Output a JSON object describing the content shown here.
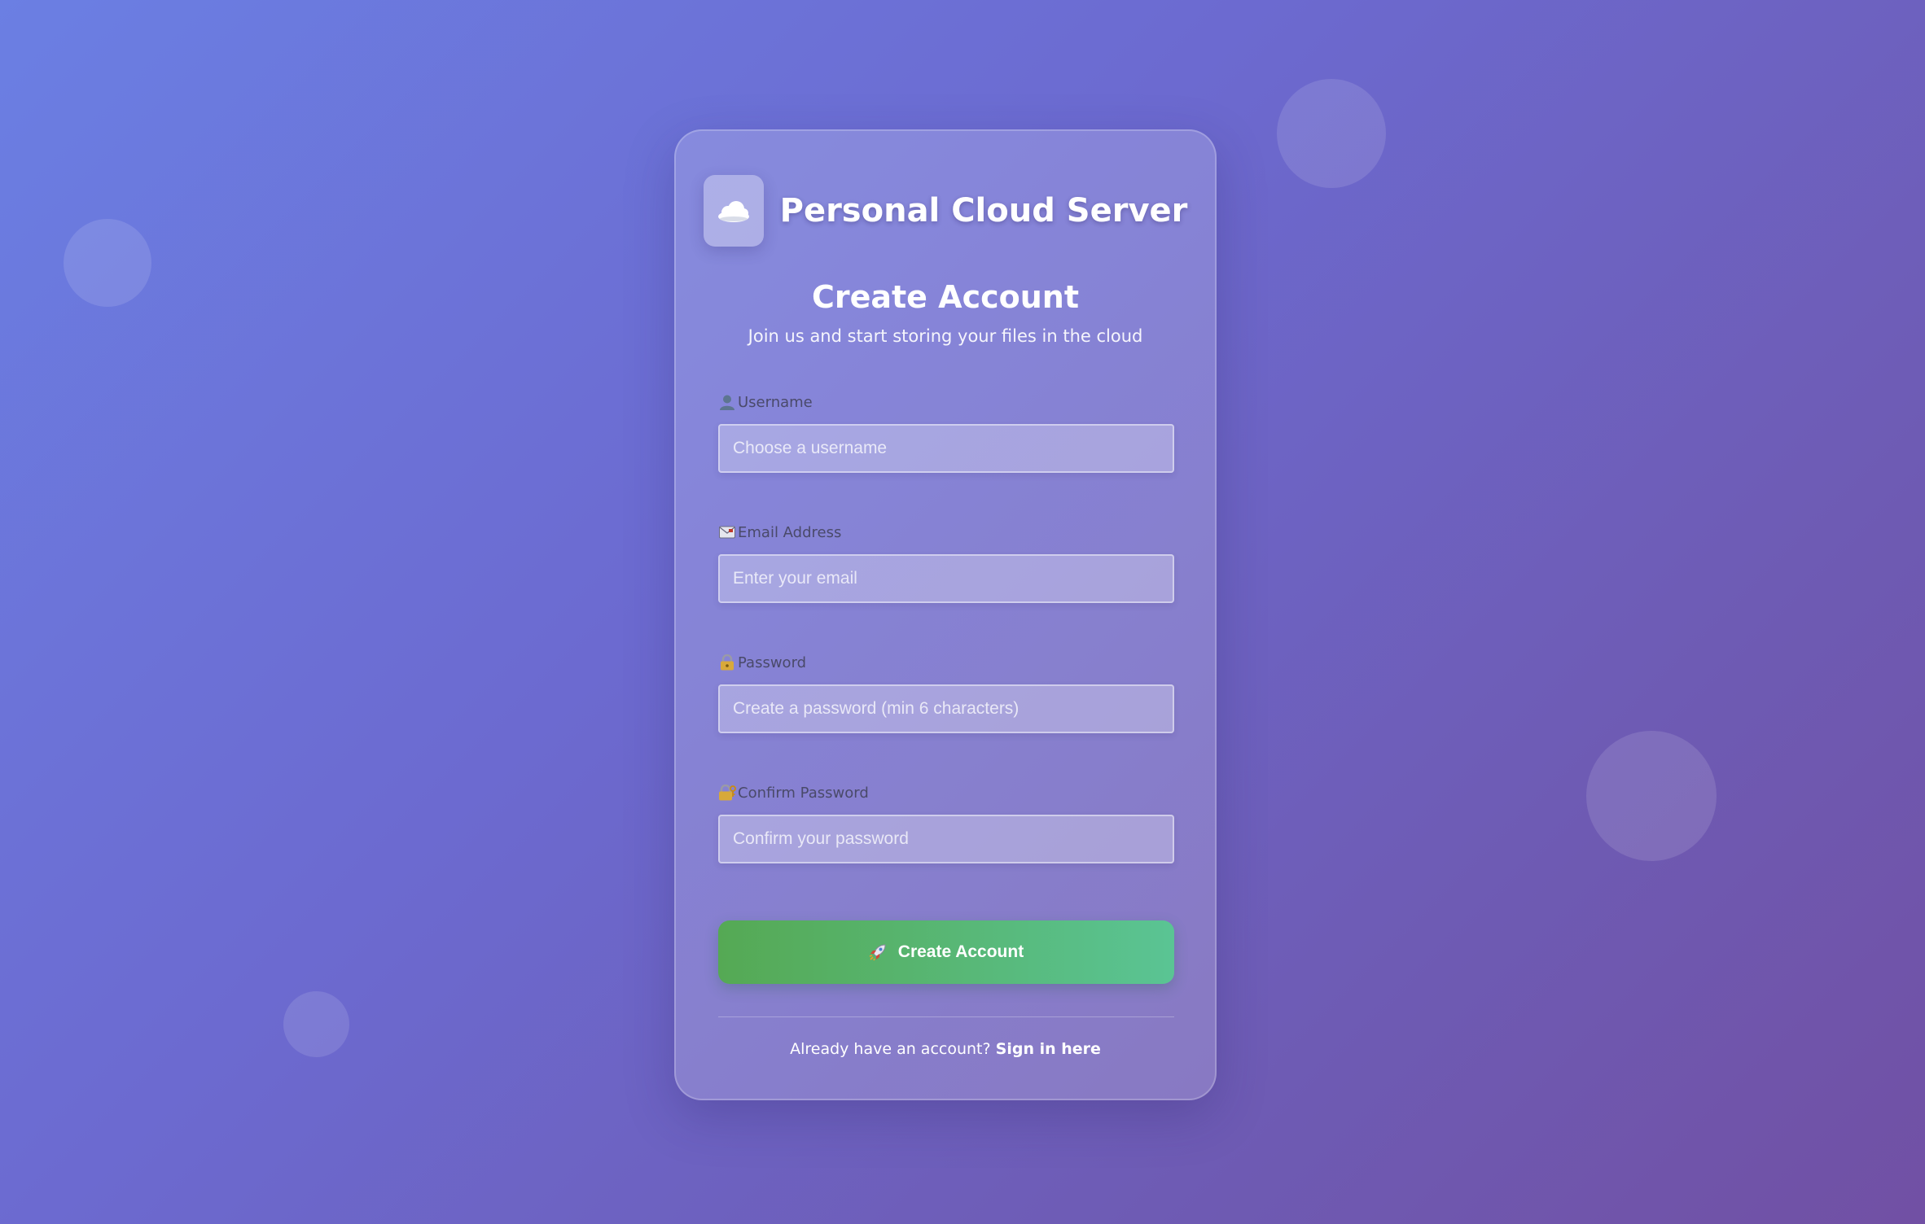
{
  "brand": {
    "icon": "cloud-icon",
    "name": "Personal Cloud Server"
  },
  "header": {
    "title": "Create Account",
    "subtitle": "Join us and start storing your files in the cloud"
  },
  "form": {
    "fields": [
      {
        "icon": "user-icon",
        "label": "Username",
        "placeholder": "Choose a username",
        "value": ""
      },
      {
        "icon": "envelope-icon",
        "label": "Email Address",
        "placeholder": "Enter your email",
        "value": ""
      },
      {
        "icon": "lock-icon",
        "label": "Password",
        "placeholder": "Create a password (min 6 characters)",
        "value": ""
      },
      {
        "icon": "lock-key-icon",
        "label": "Confirm Password",
        "placeholder": "Confirm your password",
        "value": ""
      }
    ],
    "submit": {
      "icon": "rocket-icon",
      "label": "Create Account"
    }
  },
  "footer": {
    "prompt": "Already have an account?",
    "link": "Sign in here"
  },
  "colors": {
    "background_start": "#6b7fe3",
    "background_end": "#7150a4",
    "button_start": "#55a954",
    "button_end": "#5ac494"
  }
}
